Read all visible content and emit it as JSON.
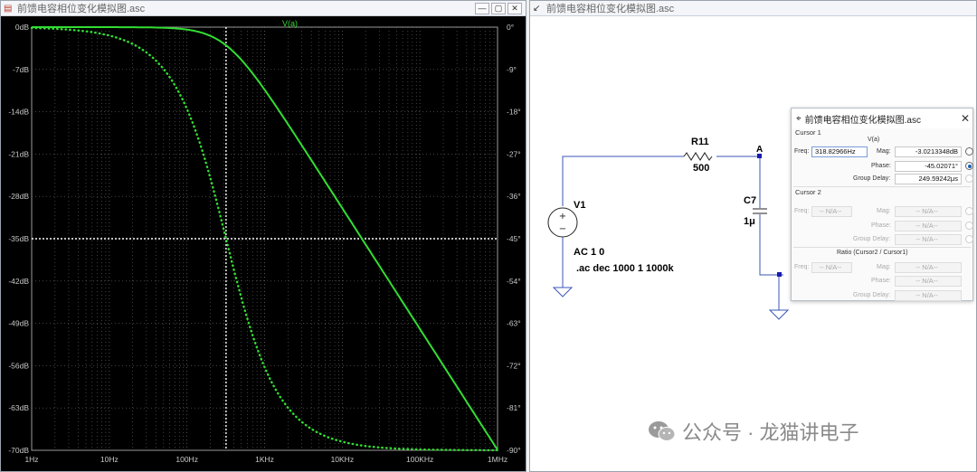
{
  "plot_window": {
    "title": "前馈电容相位变化模拟图.asc",
    "trace_label": "V(a)",
    "buttons": [
      "—",
      "▢",
      "✕"
    ]
  },
  "schematic_window": {
    "title": "前馈电容相位变化模拟图.asc"
  },
  "chart_data": {
    "type": "line",
    "trace": "V(a)",
    "x_scale": "log",
    "x_range": [
      1,
      1000000
    ],
    "x_ticks": [
      "1Hz",
      "10Hz",
      "100Hz",
      "1KHz",
      "10KHz",
      "100KHz",
      "1MHz"
    ],
    "y_left_ticks": [
      "0dB",
      "-7dB",
      "-14dB",
      "-21dB",
      "-28dB",
      "-35dB",
      "-42dB",
      "-49dB",
      "-56dB",
      "-63dB",
      "-70dB"
    ],
    "y_left_range": [
      -70,
      0
    ],
    "y_right_ticks": [
      "0°",
      "-9°",
      "-18°",
      "-27°",
      "-36°",
      "-45°",
      "-54°",
      "-63°",
      "-72°",
      "-81°",
      "-90°"
    ],
    "y_right_range": [
      -90,
      0
    ],
    "cutoff_hz": 318.83,
    "cursor_freq_hz": 318.83,
    "cursor_mag_db": -3.02,
    "series": [
      {
        "name": "Magnitude",
        "style": "solid",
        "axis": "left"
      },
      {
        "name": "Phase",
        "style": "dotted",
        "axis": "right"
      }
    ],
    "trace_color": "#33dd33",
    "grid": true
  },
  "schematic": {
    "r_name": "R11",
    "r_value": "500",
    "c_name": "C7",
    "c_value": "1μ",
    "node": "A",
    "source_name": "V1",
    "source_value": "AC 1 0",
    "directive": ".ac dec 1000 1 1000k"
  },
  "cursor_dialog": {
    "title": "前馈电容相位变化模拟图.asc",
    "close": "✕",
    "cursor1_label": "Cursor 1",
    "trace": "V(a)",
    "freq_label": "Freq:",
    "freq": "318.82966Hz",
    "mag_label": "Mag:",
    "mag": "-3.0213348dB",
    "phase_label": "Phase:",
    "phase": "-45.02071°",
    "gd_label": "Group Delay:",
    "gd": "249.59242μs",
    "cursor2_label": "Cursor 2",
    "na": "-- N/A--",
    "ratio_label": "Ratio (Cursor2 / Cursor1)"
  },
  "watermark": {
    "text": "公众号 · 龙猫讲电子"
  }
}
